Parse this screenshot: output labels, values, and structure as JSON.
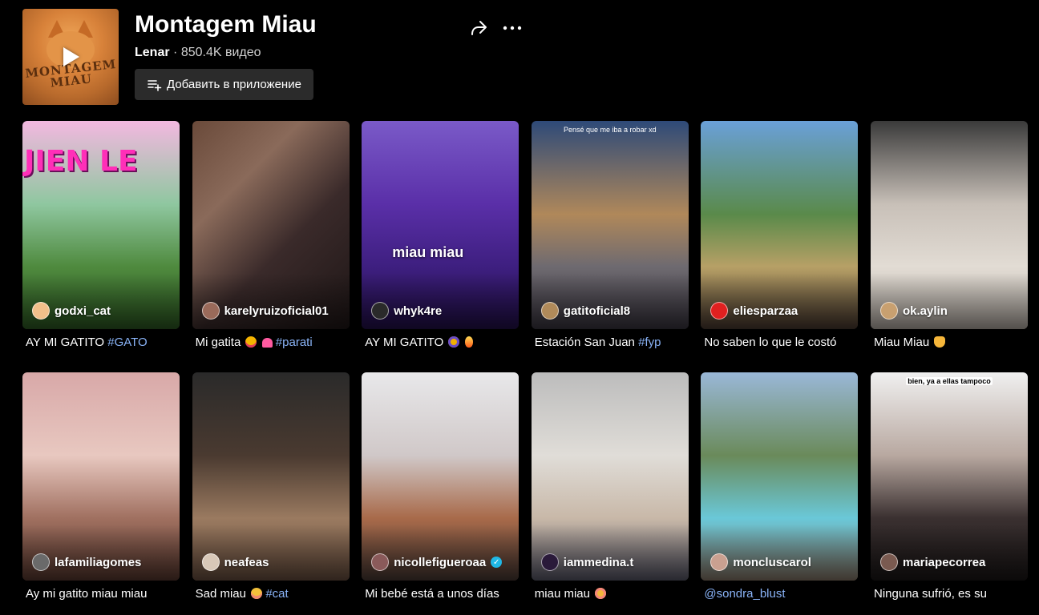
{
  "playlist": {
    "title": "Montagem Miau",
    "author": "Lenar",
    "separator": "·",
    "video_count": "850.4K видео",
    "cover_text": "MONTAGEM MIAU",
    "add_button_label": "Добавить в приложение"
  },
  "videos": [
    {
      "username": "godxi_cat",
      "caption": "AY MI GATITO ",
      "tag": "#GATO",
      "emoji": "",
      "overlay": "JIEN LE",
      "top_text": ""
    },
    {
      "username": "karelyruizoficial01",
      "caption": "Mi gatita ",
      "tag": "#parati",
      "emoji": "love,heart",
      "overlay": "",
      "top_text": ""
    },
    {
      "username": "whyk4re",
      "caption": "AY MI GATITO ",
      "tag": "",
      "emoji": "scream,fire",
      "overlay": "miau miau",
      "top_text": ""
    },
    {
      "username": "gatitoficial8",
      "caption": "Estación San Juan ",
      "tag": "#fyp",
      "emoji": "",
      "overlay": "",
      "top_text": "Pensé que me iba a robar xd"
    },
    {
      "username": "eliesparzaa",
      "caption": "No saben lo que le costó",
      "tag": "",
      "emoji": "",
      "overlay": "",
      "top_text": ""
    },
    {
      "username": "ok.aylin",
      "caption": "Miau Miau ",
      "tag": "",
      "emoji": "cat",
      "overlay": "",
      "top_text": ""
    },
    {
      "username": "lafamiliagomes",
      "caption": "Ay mi gatito miau miau",
      "tag": "",
      "emoji": "",
      "overlay": "",
      "top_text": ""
    },
    {
      "username": "neafeas",
      "caption": "Sad miau ",
      "tag": "#cat",
      "emoji": "sad",
      "overlay": "",
      "top_text": ""
    },
    {
      "username": "nicollefigueroaa",
      "caption": "Mi bebé está a unos días",
      "tag": "",
      "emoji": "",
      "overlay": "",
      "top_text": "",
      "verified": true
    },
    {
      "username": "iammedina.t",
      "caption": "miau miau ",
      "tag": "",
      "emoji": "flushed",
      "overlay": "",
      "top_text": ""
    },
    {
      "username": "moncluscarol",
      "caption": "",
      "tag": "@sondra_blust",
      "emoji": "",
      "overlay": "",
      "top_text": ""
    },
    {
      "username": "mariapecorrea",
      "caption": "Ninguna sufrió, es su",
      "tag": "",
      "emoji": "",
      "overlay": "",
      "top_text": "bien, ya a ellas tampoco"
    }
  ],
  "colors": {
    "background": "#000000",
    "button_bg": "#2b2b2b",
    "hashtag": "#8ab4f8",
    "verified": "#20b8e6"
  },
  "icons": {
    "share": "share-arrow-icon",
    "more": "more-dots-icon",
    "add_to_app": "playlist-add-icon",
    "play": "play-icon"
  }
}
